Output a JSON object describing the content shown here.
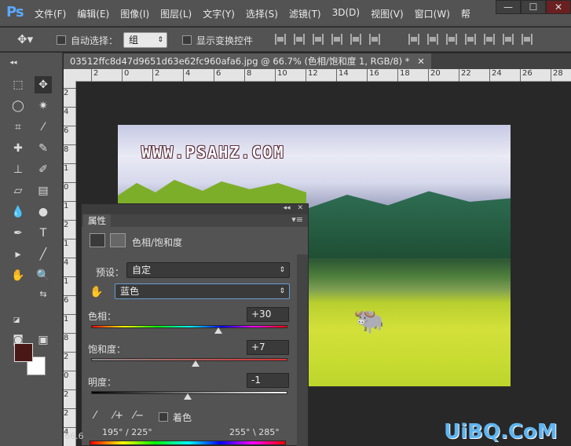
{
  "app": {
    "logo": "Ps"
  },
  "menu": [
    "文件(F)",
    "编辑(E)",
    "图像(I)",
    "图层(L)",
    "文字(Y)",
    "选择(S)",
    "滤镜(T)",
    "3D(D)",
    "视图(V)",
    "窗口(W)",
    "帮"
  ],
  "window_controls": {
    "minimize": "—",
    "restore": "☐",
    "close": "✕"
  },
  "options": {
    "auto_select_label": "自动选择：",
    "auto_select_value": "组",
    "show_transform_label": "显示变换控件"
  },
  "document": {
    "tab_title": "03512ffc8d47d9651d63e62fc960afa6.jpg @ 66.7% (色相/饱和度 1, RGB/8) *",
    "zoom": "66.6",
    "watermark": "WWW.PSAHZ.COM",
    "ruler_h": [
      "2",
      "0",
      "2",
      "4",
      "6",
      "8",
      "10",
      "12",
      "14",
      "16",
      "18",
      "20",
      "22",
      "24",
      "26",
      "28"
    ],
    "ruler_v": [
      "2",
      "4",
      "6",
      "8",
      "1",
      "0",
      "1",
      "2",
      "1",
      "4",
      "1",
      "6",
      "1",
      "8",
      "2",
      "0",
      "2",
      "2",
      "4"
    ]
  },
  "panel": {
    "collapse": "◂◂",
    "close": "✕",
    "tab": "属性",
    "menu_icon": "▾≡",
    "title": "色相/饱和度",
    "preset_label": "预设：",
    "preset_value": "自定",
    "channel_value": "蓝色",
    "hue_label": "色相：",
    "hue_value": "+30",
    "saturation_label": "饱和度：",
    "saturation_value": "+7",
    "lightness_label": "明度：",
    "lightness_value": "-1",
    "colorize_label": "着色",
    "range_left": "195° / 225°",
    "range_right": "255° \\ 285°"
  },
  "footer_watermark": "UiBQ.CoM"
}
